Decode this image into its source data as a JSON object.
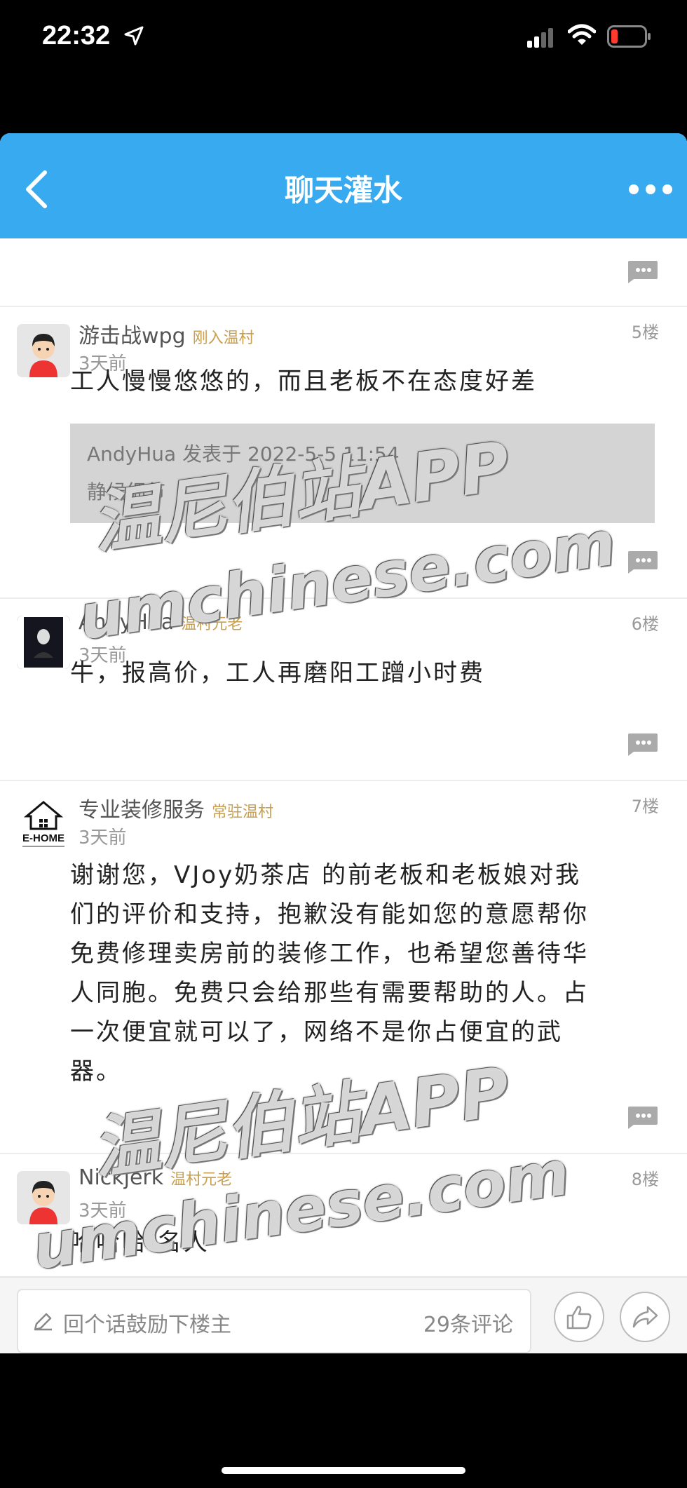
{
  "status_bar": {
    "time": "22:32"
  },
  "header": {
    "title": "聊天灌水"
  },
  "posts": [
    {
      "username": "游击战wpg",
      "badge": "刚入温村",
      "time": "3天前",
      "floor": "5楼",
      "content": "工人慢慢悠悠的，而且老板不在态度好差",
      "quote": {
        "header": "AndyHua 发表于 2022-5-5 11:54",
        "text": "静候细节"
      }
    },
    {
      "username": "AndyHua",
      "badge": "温村元老",
      "time": "3天前",
      "floor": "6楼",
      "content": "牛，报高价，工人再磨阳工蹭小时费"
    },
    {
      "username": "专业装修服务",
      "badge": "常驻温村",
      "time": "3天前",
      "floor": "7楼",
      "avatar_text": "E-HOME",
      "content_lines": [
        "谢谢您，VJoy奶茶店 的前老板和老板娘对我",
        "们的评价和支持，抱歉没有能如您的意愿帮你",
        "免费修理卖房前的装修工作，也希望您善待华",
        "人同胞。免费只会给那些有需要帮助的人。占",
        "一次便宜就可以了，网络不是你占便宜的武",
        "器。"
      ]
    },
    {
      "username": "Nickjerk",
      "badge": "温村元老",
      "time": "3天前",
      "floor": "8楼",
      "content": "哈哈哈 名人"
    }
  ],
  "bottom_bar": {
    "comment_placeholder": "回个话鼓励下楼主",
    "comment_count": "29条评论"
  },
  "watermark": {
    "line1": "温尼伯站APP",
    "line2": "umchinese.com"
  },
  "colors": {
    "nav_blue": "#37aaf0",
    "badge_gold": "#c8a050"
  },
  "icons": [
    "location-arrow-icon",
    "signal-icon",
    "wifi-icon",
    "battery-icon",
    "back-chevron-icon",
    "more-icon",
    "reply-bubble-icon",
    "pen-icon",
    "thumbs-up-icon",
    "share-icon"
  ]
}
